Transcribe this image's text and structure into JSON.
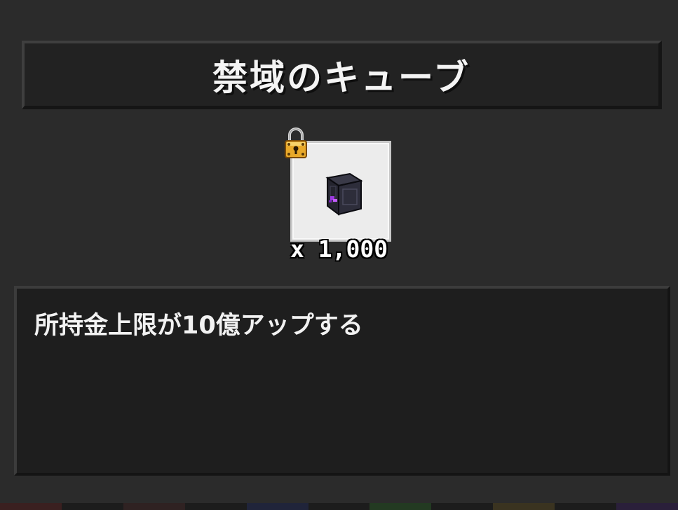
{
  "dialog": {
    "title": "禁域のキューブ",
    "item": {
      "icon": "dark-cube-icon",
      "locked_icon": "padlock-icon",
      "quantity": "x 1,000"
    },
    "description": "所持金上限が10億アップする"
  },
  "colors": {
    "background": "#2b2b2b",
    "panel": "#222222",
    "slot": "#ececec",
    "cube_glow": "#9b3ae0"
  }
}
